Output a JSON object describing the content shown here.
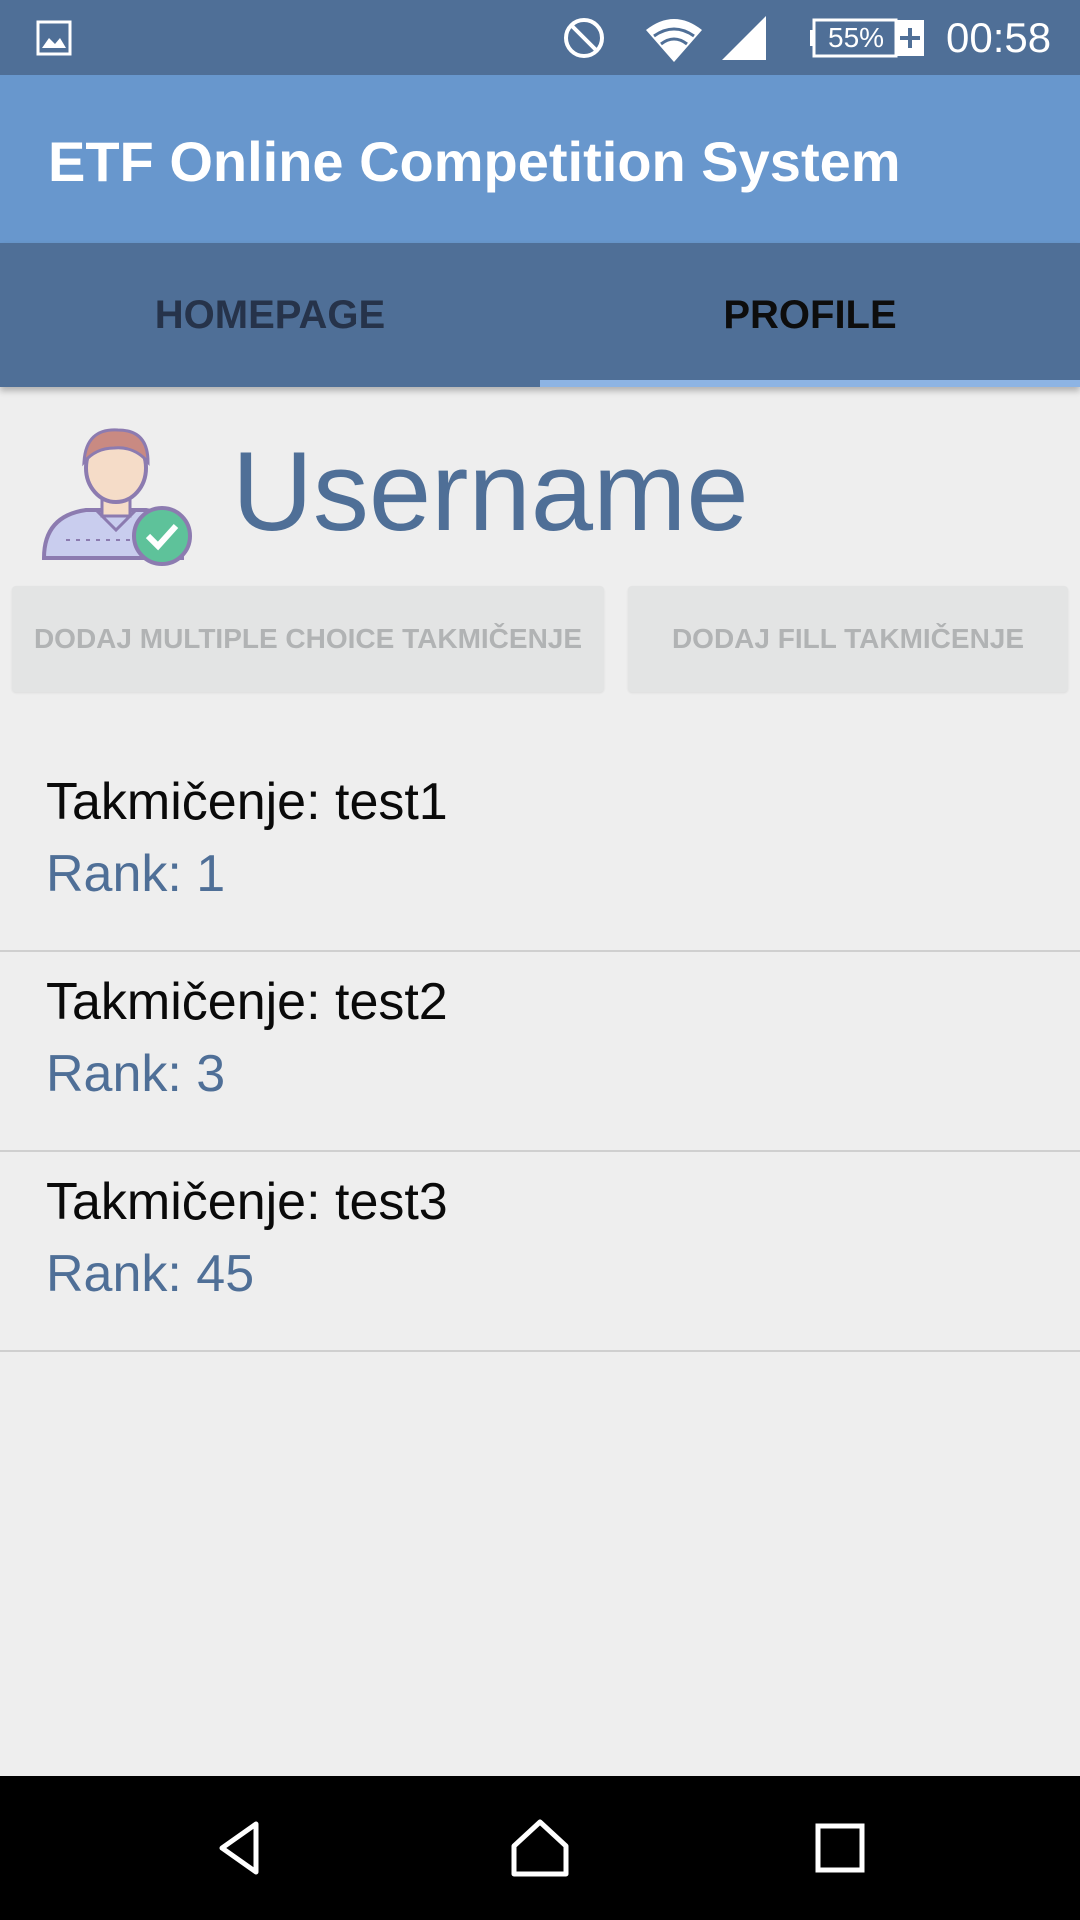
{
  "status_bar": {
    "battery_percent": "55%",
    "time": "00:58",
    "icons": [
      "gallery-icon",
      "do-not-disturb-icon",
      "wifi-icon",
      "cell-signal-icon",
      "battery-charging-icon"
    ]
  },
  "app_bar": {
    "title": "ETF Online Competition System"
  },
  "tabs": [
    {
      "label": "HOMEPAGE",
      "active": false
    },
    {
      "label": "PROFILE",
      "active": true
    }
  ],
  "profile": {
    "username": "Username",
    "avatar_icon": "verified-user-icon"
  },
  "actions": {
    "add_multiple_choice": "DODAJ MULTIPLE CHOICE TAKMIČENJE",
    "add_fill": "DODAJ FILL TAKMIČENJE"
  },
  "competitions": [
    {
      "name": "Takmičenje: test1",
      "rank": "Rank: 1"
    },
    {
      "name": "Takmičenje: test2",
      "rank": "Rank: 3"
    },
    {
      "name": "Takmičenje: test3",
      "rank": "Rank: 45"
    }
  ],
  "nav_bar": {
    "icons": [
      "back-icon",
      "home-icon",
      "recents-icon"
    ]
  },
  "colors": {
    "primary_dark": "#4f6f97",
    "primary": "#6897cd",
    "tab_indicator": "#8db4e4",
    "background": "#eeeeee"
  }
}
